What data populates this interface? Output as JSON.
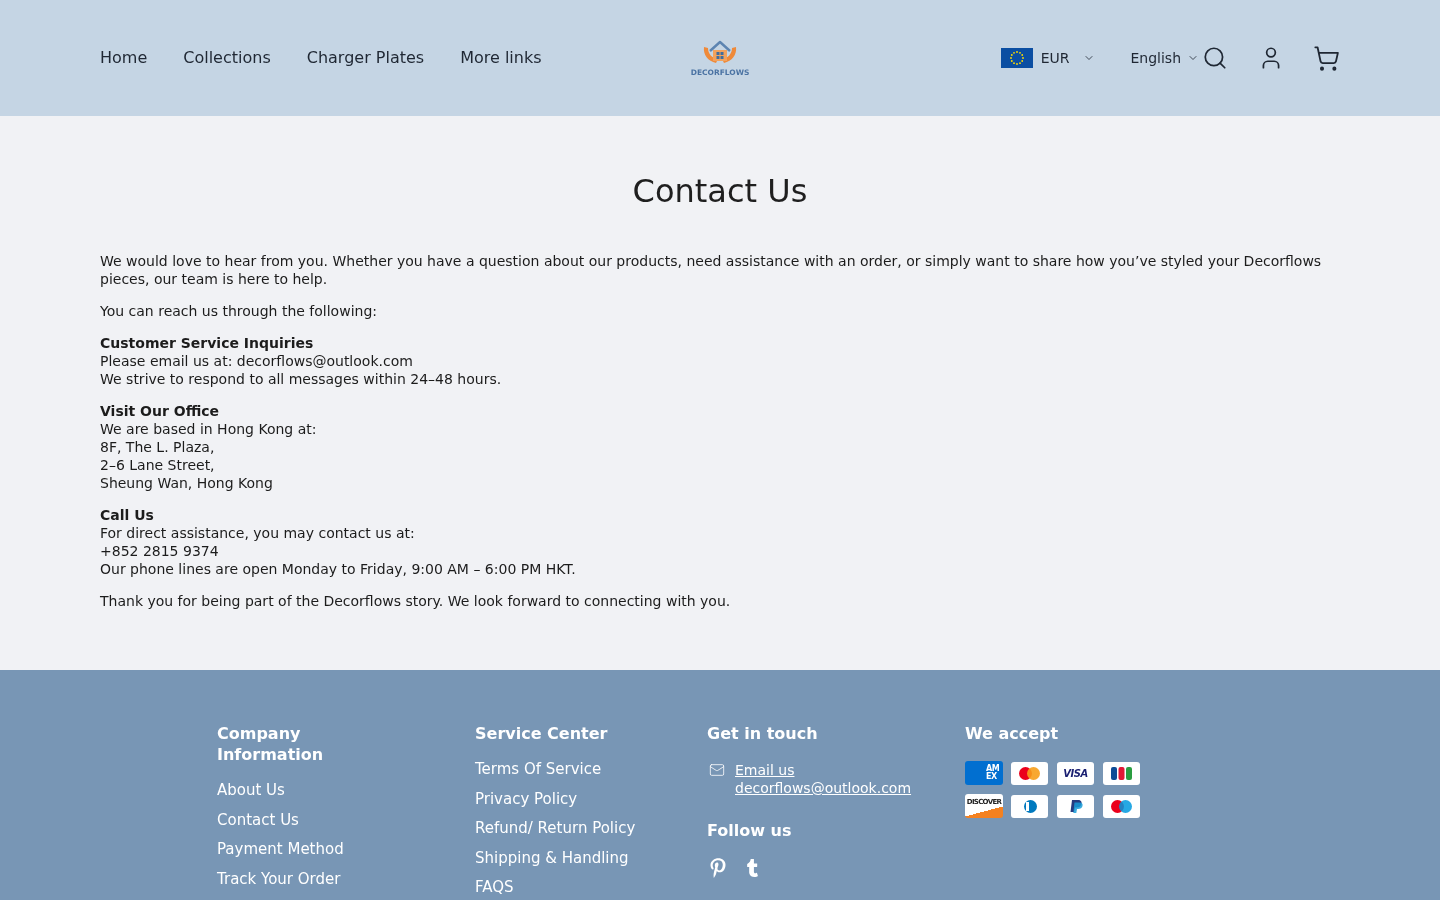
{
  "header": {
    "nav": [
      "Home",
      "Collections",
      "Charger Plates",
      "More links"
    ],
    "logo": {
      "text": "DECORFLOWS"
    },
    "currency": "EUR",
    "language": "English"
  },
  "content": {
    "title": "Contact Us",
    "blocks": [
      {
        "kind": "paragraph",
        "text": "We would love to hear from you. Whether you have a question about our products, need assistance with an order, or simply want to share how you’ve styled your Decorflows pieces, our team is here to help."
      },
      {
        "kind": "paragraph",
        "text": "You can reach us through the following:"
      },
      {
        "kind": "section",
        "heading": "Customer Service Inquiries",
        "lines": [
          "Please email us at: decorflows@outlook.com",
          "We strive to respond to all messages within 24–48 hours."
        ]
      },
      {
        "kind": "section",
        "heading": "Visit Our Office",
        "lines": [
          "We are based in Hong Kong at:",
          "8F, The L. Plaza,",
          "2–6 Lane Street,",
          "Sheung Wan, Hong Kong"
        ]
      },
      {
        "kind": "section",
        "heading": "Call Us",
        "lines": [
          "For direct assistance, you may contact us at:",
          "+852 2815 9374",
          "Our phone lines are open Monday to Friday, 9:00 AM – 6:00 PM HKT."
        ]
      },
      {
        "kind": "paragraph",
        "text": "Thank you for being part of the Decorflows story. We look forward to connecting with you."
      }
    ]
  },
  "footer": {
    "columns": [
      {
        "kind": "links",
        "heading": "Company Information",
        "links": [
          "About Us",
          "Contact Us",
          "Payment Method",
          "Track Your Order"
        ]
      },
      {
        "kind": "links",
        "heading": "Service Center",
        "links": [
          "Terms Of Service",
          "Privacy Policy",
          "Refund/ Return Policy",
          "Shipping & Handling",
          "FAQS"
        ]
      },
      {
        "kind": "contact",
        "heading": "Get in touch",
        "email_link": "Email us decorflows@outlook.com",
        "follow_heading": "Follow us",
        "social": [
          {
            "kind": "pinterest"
          },
          {
            "kind": "tumblr"
          }
        ]
      },
      {
        "kind": "payments",
        "heading": "We accept",
        "cards": [
          {
            "kind": "amex",
            "label": "AMEX"
          },
          {
            "kind": "mastercard"
          },
          {
            "kind": "visa",
            "label": "VISA"
          },
          {
            "kind": "jcb"
          },
          {
            "kind": "discover",
            "label": "DISCOVER"
          },
          {
            "kind": "diners"
          },
          {
            "kind": "paypal"
          },
          {
            "kind": "maestro"
          }
        ]
      }
    ]
  }
}
